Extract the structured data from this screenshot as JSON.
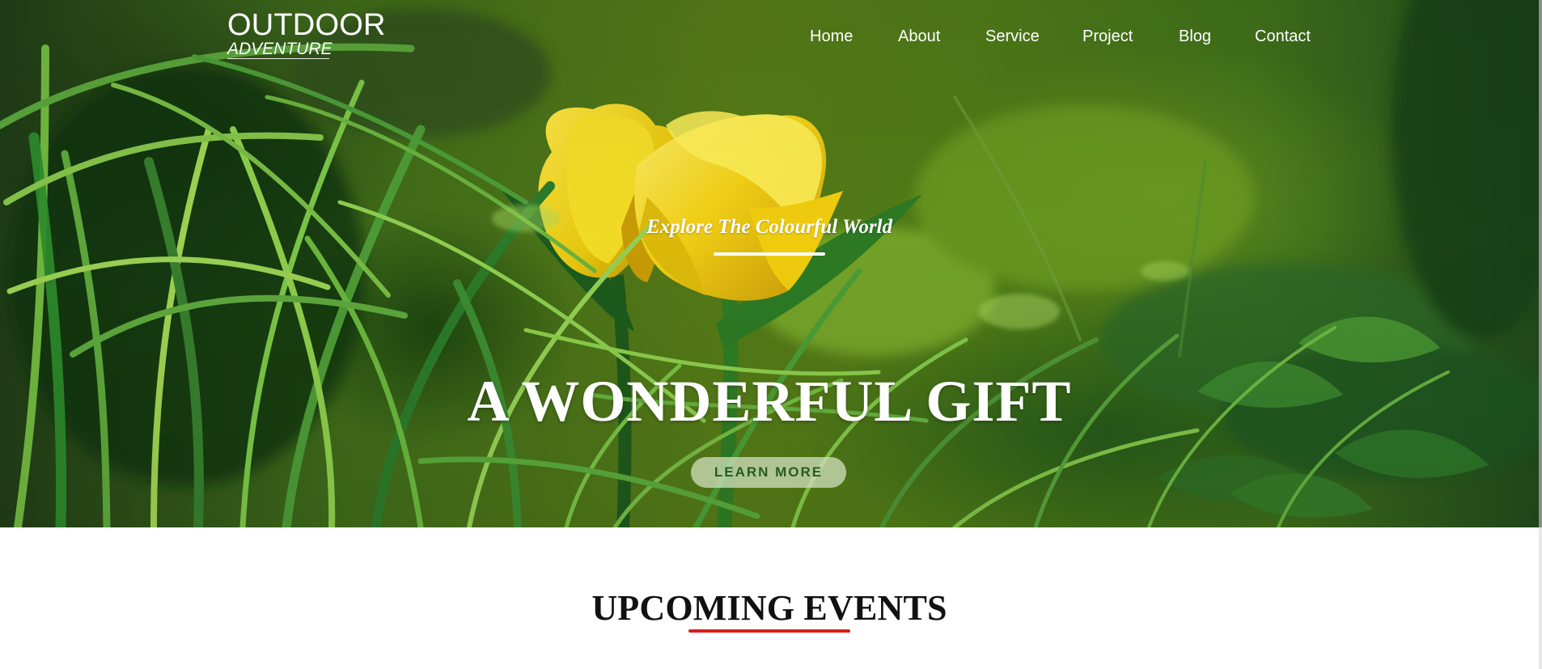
{
  "brand": {
    "title": "OUTDOOR",
    "subtitle": "ADVENTURE"
  },
  "nav": {
    "items": [
      {
        "label": "Home"
      },
      {
        "label": "About"
      },
      {
        "label": "Service"
      },
      {
        "label": "Project"
      },
      {
        "label": "Blog"
      },
      {
        "label": "Contact"
      }
    ]
  },
  "hero": {
    "image_description_name": "yellow-tulip-grass-hero-image",
    "tagline": "Explore The Colourful World",
    "headline": "A WONDERFUL GIFT",
    "button_label": "LEARN MORE"
  },
  "events": {
    "title": "UPCOMING EVENTS"
  },
  "colors": {
    "accent_red": "#d91c1c",
    "button_green_text": "#245d24",
    "hero_green": "#4f7b17",
    "tulip_yellow": "#f2d313"
  }
}
